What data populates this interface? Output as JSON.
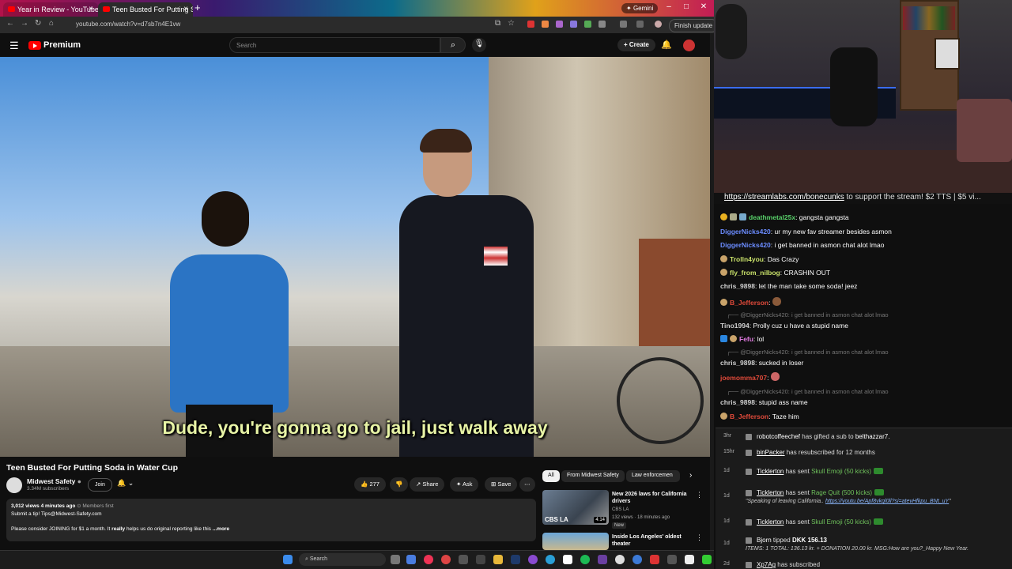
{
  "browser": {
    "tabs": [
      {
        "label": "Year in Review - YouTube"
      },
      {
        "label": "Teen Busted For Putting So"
      }
    ],
    "gemini_label": "Gemini",
    "url": "youtube.com/watch?v=d7sb7n4E1vw",
    "finish_update": "Finish update"
  },
  "youtube": {
    "logo": "Premium",
    "search_placeholder": "Search",
    "create_label": "Create",
    "caption": "Dude, you're gonna go to jail, just walk away",
    "video_title": "Teen Busted For Putting Soda in Water Cup",
    "channel": "Midwest Safety",
    "subscribers": "3.34M subscribers",
    "join_label": "Join",
    "likes": "277",
    "share_label": "Share",
    "ask_label": "Ask",
    "save_label": "Save",
    "desc_stats": "3,012 views  4 minutes ago",
    "desc_members": "Members first",
    "desc_line1": "Submit a tip! Tips@Midwest-Safety.com",
    "desc_line2_pre": "Please consider JOINING for $1 a month. It ",
    "desc_line2_bold": "really",
    "desc_line2_post": " helps us do original reporting like this",
    "desc_more": "...more",
    "chips": [
      "All",
      "From Midwest Safety",
      "Law enforcemen"
    ],
    "recommendations": [
      {
        "title": "New 2026 laws for California drivers",
        "channel": "CBS LA",
        "meta": "132 views · 18 minutes ago",
        "badge": "New",
        "duration": "4:14",
        "thumb_label": "CBS LA"
      },
      {
        "title": "Inside Los Angeles' oldest theater"
      }
    ],
    "taskbar_search": "Search"
  },
  "stream": {
    "banner_link": "https://streamlabs.com/bonecunks",
    "banner_text": " to support the stream! $2 TTS | $5 vi...",
    "chat": [
      {
        "user": "deathmetal25x",
        "msg": "gangsta gangsta",
        "color": "#58d16a"
      },
      {
        "user": "DiggerNicks420",
        "msg": "ur my new fav streamer besides asmon",
        "color": "#6b8cff"
      },
      {
        "user": "DiggerNicks420",
        "msg": "i get banned in asmon chat alot lmao",
        "color": "#6b8cff"
      },
      {
        "user": "Trolln4you",
        "msg": "Das Crazy",
        "color": "#c8e06a"
      },
      {
        "user": "fly_from_nilbog",
        "msg": "CRASHIN OUT",
        "color": "#c8e06a"
      },
      {
        "user": "chris_9898",
        "msg": "let the man take some soda! jeez",
        "color": "#cfcfcf"
      },
      {
        "user": "B_Jefferson",
        "msg": "",
        "color": "#e04a3a"
      },
      {
        "reply": "@DiggerNicks420: i get banned in asmon chat alot lmao"
      },
      {
        "user": "Tino1994",
        "msg": "Prolly cuz u have a stupid name",
        "color": "#cfcfcf"
      },
      {
        "user": "Fefu",
        "msg": "lol",
        "color": "#e07ae0"
      },
      {
        "reply": "@DiggerNicks420: i get banned in asmon chat alot lmao"
      },
      {
        "user": "chris_9898",
        "msg": "sucked in loser",
        "color": "#cfcfcf"
      },
      {
        "user": "joemomma707",
        "msg": "",
        "color": "#e04a3a"
      },
      {
        "reply": "@DiggerNicks420: i get banned in asmon chat alot lmao"
      },
      {
        "user": "chris_9898",
        "msg": "stupid ass name",
        "color": "#cfcfcf"
      },
      {
        "user": "B_Jefferson",
        "msg": "Taze him",
        "color": "#e04a3a"
      }
    ],
    "events": [
      {
        "time": "3hr",
        "name": "robotcoffeechef",
        "text": " has gifted a sub to ",
        "target": "belthazzar7."
      },
      {
        "time": "15hr",
        "name": "binPacker",
        "text": " has resubscribed for 12 months"
      },
      {
        "time": "1d",
        "name": "Ticklerton",
        "text": " has sent ",
        "gift": "Skull Emoji (50 kicks)"
      },
      {
        "time": "1d",
        "name": "Ticklerton",
        "text": " has sent ",
        "gift": "Rage Quit (500 kicks)",
        "sub_pre": "\"Speaking of leaving California.. ",
        "sub_link": "https://youtu.be/Apf8vkql0ll?si=atevHfkpu_BNt_uY",
        "sub_post": "\""
      },
      {
        "time": "1d",
        "name": "Ticklerton",
        "text": " has sent ",
        "gift": "Skull Emoji (50 kicks)"
      },
      {
        "time": "1d",
        "name": "Bjorn",
        "text": " tipped ",
        "amount": "DKK 156.13",
        "sub_plain": "ITEMS: 1 TOTAL: 136.13 kr. + DONATION 20.00 kr. MSG:How are you?_Happy New Year."
      },
      {
        "time": "2d",
        "name": "Xp7Ag",
        "text": " has subscribed"
      }
    ]
  }
}
